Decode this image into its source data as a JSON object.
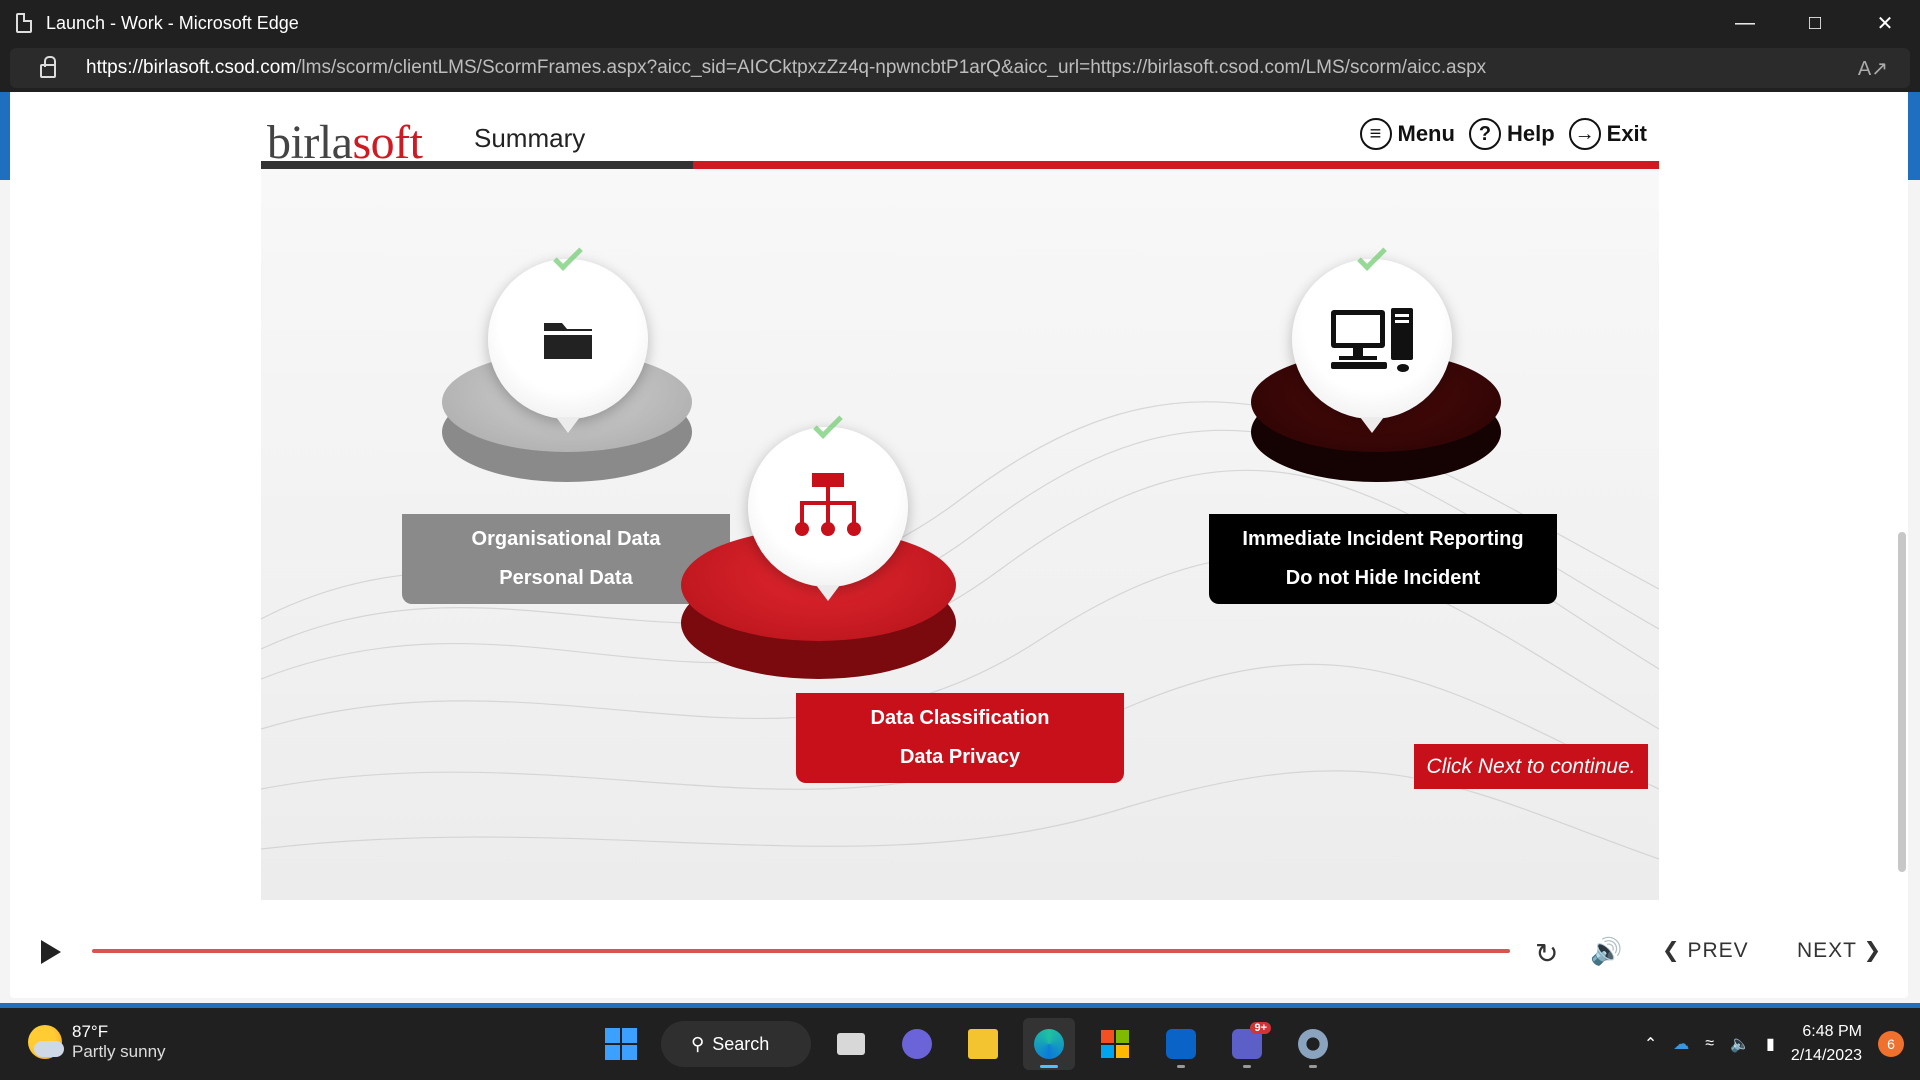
{
  "window": {
    "title": "Launch - Work - Microsoft Edge",
    "url_host": "https://birlasoft.csod.com",
    "url_path": "/lms/scorm/clientLMS/ScormFrames.aspx?aicc_sid=AICCktpxzZz4q-npwncbtP1arQ&aicc_url=https://birlasoft.csod.com/LMS/scorm/aicc.aspx"
  },
  "course": {
    "logo_part1": "birla",
    "logo_part2": "soft",
    "page_title": "Summary",
    "nav": {
      "menu": "Menu",
      "help": "Help",
      "exit": "Exit"
    },
    "cards": [
      {
        "line1": "Organisational Data",
        "line2": "Personal Data",
        "icon": "folder-icon"
      },
      {
        "line1": "Data Classification",
        "line2": "Data Privacy",
        "icon": "hierarchy-icon"
      },
      {
        "line1": "Immediate Incident Reporting",
        "line2": "Do not Hide Incident",
        "icon": "computer-icon"
      }
    ],
    "cta": "Click Next to continue."
  },
  "player": {
    "prev": "PREV",
    "next": "NEXT",
    "progress": 1.0
  },
  "taskbar": {
    "temp": "87°F",
    "weather": "Partly sunny",
    "search": "Search",
    "teams_badge": "9+",
    "time": "6:48 PM",
    "date": "2/14/2023",
    "notifications": "6"
  },
  "colors": {
    "accent_red": "#d01a23",
    "dark_maroon": "#3a0606",
    "grey": "#8a8a8a"
  }
}
